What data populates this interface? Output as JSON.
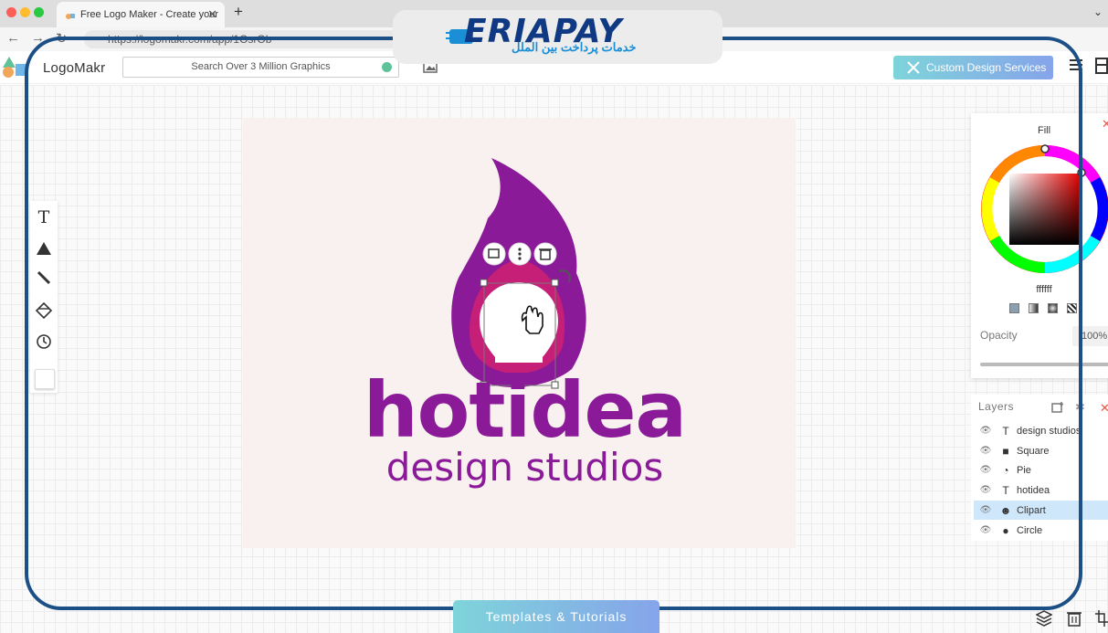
{
  "browser": {
    "tab_title": "Free Logo Maker - Create your",
    "url": "https://logomakr.com/app/1OsrOb"
  },
  "app": {
    "name": "LogoMakr",
    "search_placeholder": "Search Over 3 Million Graphics",
    "custom_design_label": "Custom Design Services"
  },
  "canvas": {
    "brand_name": "hotidea",
    "tagline": "design studios",
    "colors": {
      "purple": "#8b1a98",
      "magenta": "#c61f78",
      "background": "#f9f1f0"
    }
  },
  "fill_panel": {
    "title": "Fill",
    "hex_value": "ffffff",
    "opacity_label": "Opacity",
    "opacity_value": "100%"
  },
  "layers": {
    "title": "Layers",
    "items": [
      {
        "label": "design studios",
        "icon": "T",
        "selected": false
      },
      {
        "label": "Square",
        "icon": "■",
        "selected": false
      },
      {
        "label": "Pie",
        "icon": "◔",
        "selected": false
      },
      {
        "label": "hotidea",
        "icon": "T",
        "selected": false
      },
      {
        "label": "Clipart",
        "icon": "☻",
        "selected": true
      },
      {
        "label": "Circle",
        "icon": "●",
        "selected": false
      }
    ]
  },
  "bottom": {
    "templates_label": "Templates & Tutorials"
  },
  "watermark": {
    "brand": "ERIAPAY",
    "tagline": "خدمات پرداخت بین الملل"
  }
}
